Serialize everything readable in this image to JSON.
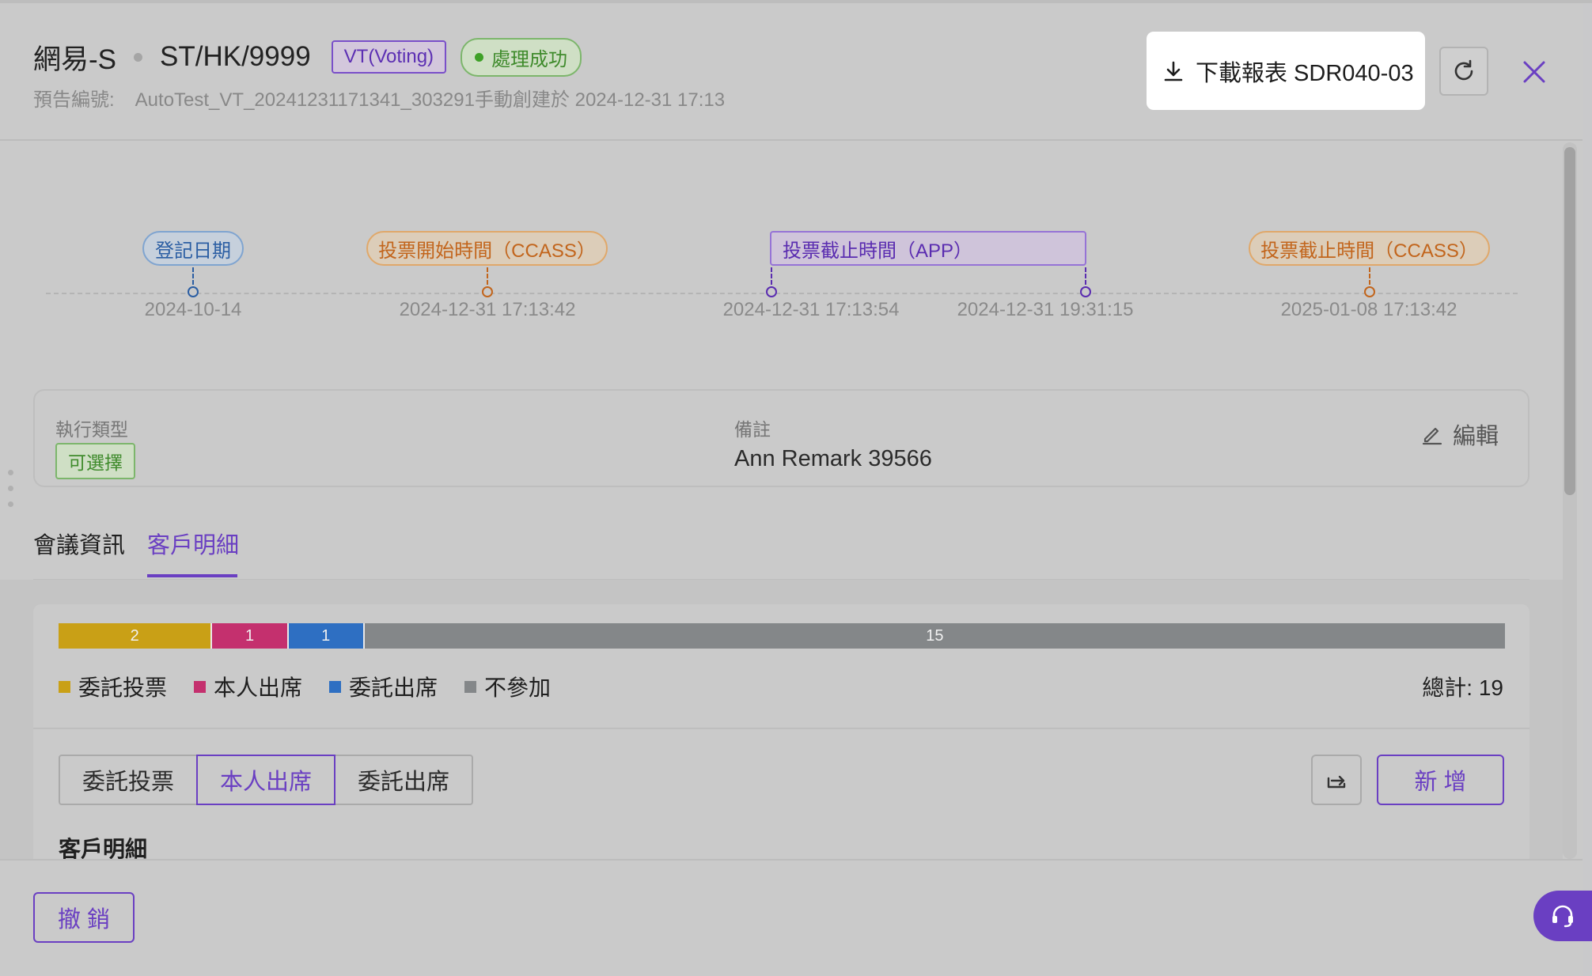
{
  "header": {
    "title": "網易-S",
    "code": "ST/HK/9999",
    "type_tag": "VT(Voting)",
    "status_tag": "處理成功",
    "subtitle_label": "預告編號:",
    "subtitle_value": "AutoTest_VT_20241231171341_303291手動創建於 2024-12-31 17:13",
    "download_label": "下載報表 SDR040-03"
  },
  "timeline": {
    "labels": [
      "登記日期",
      "投票開始時間（CCASS）",
      "投票截止時間（APP）",
      "投票截止時間（CCASS）"
    ],
    "dates": [
      "2024-10-14",
      "2024-12-31 17:13:42",
      "2024-12-31 17:13:54",
      "2024-12-31 19:31:15",
      "2025-01-08 17:13:42"
    ]
  },
  "info": {
    "exec_type_label": "執行類型",
    "exec_type_value": "可選擇",
    "remark_label": "備註",
    "remark_value": "Ann Remark 39566",
    "edit_label": "編輯"
  },
  "tabs": [
    {
      "label": "會議資訊",
      "active": false
    },
    {
      "label": "客戶明細",
      "active": true
    }
  ],
  "chart_data": {
    "type": "bar",
    "orientation": "horizontal-stacked",
    "categories": [
      "委託投票",
      "本人出席",
      "委託出席",
      "不參加"
    ],
    "values": [
      2,
      1,
      1,
      15
    ],
    "colors": [
      "#c9a016",
      "#c4306e",
      "#2e6fc2",
      "#848789"
    ],
    "total": 19
  },
  "summary": {
    "legend": [
      "委託投票",
      "本人出席",
      "委託出席",
      "不參加"
    ],
    "total_label": "總計: 19"
  },
  "filter": {
    "options": [
      "委託投票",
      "本人出席",
      "委託出席"
    ],
    "selected": "本人出席"
  },
  "actions": {
    "add_label": "新 增",
    "section_title": "客戶明細"
  },
  "footer": {
    "revoke_label": "撤 銷"
  },
  "icons": {
    "download": "download-icon",
    "refresh": "refresh-icon",
    "close": "close-icon",
    "edit": "edit-icon",
    "export": "export-icon",
    "help": "headset-icon"
  },
  "colors": {
    "accent": "#6a3fc2",
    "success": "#3f8b2c"
  }
}
